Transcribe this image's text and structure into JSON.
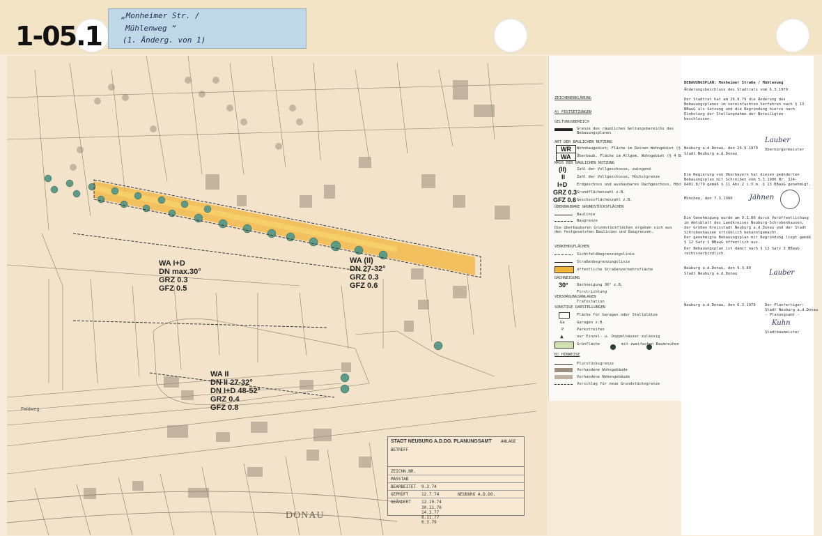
{
  "header": {
    "plan_number": "1-05.1",
    "label_line1": "„Monheimer Str. /",
    "label_line2": "Mühlenweg “",
    "label_line3": "(1. Änderg. von 1)"
  },
  "map": {
    "zones": [
      {
        "lines": [
          "WA I+D",
          "DN max.30°",
          "GRZ 0.3",
          "GFZ 0.5"
        ]
      },
      {
        "lines": [
          "WA (II)",
          "DN 27-32°",
          "GRZ 0.3",
          "GFZ 0.6"
        ]
      },
      {
        "lines": [
          "WA II",
          "DN II 27-32°",
          "DN I+D 48-52°",
          "GRZ 0.4",
          "GFZ 0.8"
        ]
      }
    ],
    "river_label": "DONAU",
    "street_label": "Feldweg",
    "highlight_color": "#f2b43a",
    "tree_color": "#5f9a86"
  },
  "title_block": {
    "office": "STADT NEUBURG A.D.DO. PLANUNGSAMT",
    "attachment": "ANLAGE",
    "subject_label": "BETREFF",
    "drawing_no_label": "ZEICHN.NR.",
    "scale_label": "MASSTAB",
    "processed_label": "BEARBEITET",
    "processed_date": "9.3.74",
    "checked_label": "GEPRÜFT",
    "checked_date": "12.7.74",
    "checked_place": "NEUBURG A.D.DO.",
    "changed_label": "GEÄNDERT",
    "changed_date": "12.10.74",
    "changed_extra": [
      "30.11.76",
      "14.3.77",
      "8.11.77",
      "6.3.79"
    ]
  },
  "legend": {
    "heading": "ZEICHENERKLÄRUNG",
    "section_a": "A) FESTSETZUNGEN",
    "boundary_heading": "GELTUNGSBEREICH",
    "boundary_text": "Grenze des räumlichen Geltungsbereichs des Bebauungsplanes",
    "use_heading": "ART DER BAULICHEN NUTZUNG",
    "wr_symbol": "WR",
    "wr_text": "Wohnbaugebiet; Fläche im Reinen Wohngebiet (§ 3 BauNV)",
    "wa_symbol": "WA",
    "wa_text": "Überbaub. Fläche im Allgem. Wohngebiet (§ 4 BauNV)",
    "measure_heading": "MASS DER BAULICHEN NUTZUNG",
    "sym_ii_circ": "(II)",
    "txt_ii_circ": "Zahl der Vollgeschosse, zwingend",
    "sym_ii": "II",
    "txt_ii": "Zahl der Vollgeschosse, Höchstgrenze",
    "sym_id": "I+D",
    "txt_id": "Erdgeschoss und ausbaubares Dachgeschoss, Höchstgrenze",
    "sym_grz": "GRZ 0.3",
    "txt_grz": "Grundflächenzahl z.B.",
    "sym_gfz": "GFZ 0.6",
    "txt_gfz": "Geschossflächenzahl z.B.",
    "building_heading": "ÜBERBAUBARE GRUNDSTÜCKSFLÄCHEN",
    "building_line": "Baulinie",
    "building_limit": "Baugrenze",
    "building_note": "Die überbaubaren Grundstückflächen ergeben sich aus den festgesetzten Baulinien und Baugrenzen.",
    "traffic_heading": "VERKEHRSFLÄCHEN",
    "traffic_1": "Sichtfeldbegrenzungslinie",
    "traffic_2": "Straßenbegrenzungslinie",
    "traffic_3": "öffentliche Straßenverkehrsfläche",
    "roof_heading": "DACHNEIGUNG",
    "roof_symbol": "30°",
    "roof_text": "Dachneigung 30° z.B.",
    "direction_text": "Firstrichtung",
    "supply_heading": "VERSORGUNGSANLAGEN",
    "transform_text": "Trafostation",
    "notes_heading": "SONSTIGE DARSTELLUNGEN",
    "garage_text": "Fläche für Garagen oder Stellplätze",
    "ga_symbol": "Ga",
    "ga_text": "Garagen z.B.",
    "p_symbol": "P",
    "p_text": "Parkstreifen",
    "house_text": "nur Einzel- u. Doppelhäuser zulässig",
    "green_text": "Grünfläche",
    "green_2": "mit zweifachen Baumreihen",
    "plant_heading": "B) HINWEISE",
    "parcel_text": "Flurstücksgrenze",
    "existing_res": "Vorhandene Wohngebäude",
    "existing_side": "Vorhandene Nebengebäude",
    "split_text": "Vorschlag für neue Grundstücksgrenze"
  },
  "procedure": {
    "title": "BEBAUUNGSPLAN: Monheimer Straße / Mühlenweg",
    "decision": "Änderungsbeschluss des Stadtrats vom 6.3.1979",
    "p1": "Der Stadtrat hat am 26.9.79 die Änderung des Bebauungsplanes im vereinfachten Verfahren nach § 13 BBauG als Satzung und die Begründung hierzu nach Einholung der Stellungnahme der Beteiligten beschlossen.",
    "place_date_1": "Neuburg a.d.Donau, den 26.9.1979",
    "city_1": "Stadt Neuburg a.d.Donau",
    "mayor": "Oberbürgermeister",
    "p2": "Die Regierung von Oberbayern hat diesen geänderten Bebauungsplan mit Schreiben vom 5.3.1980 Nr. 324-6401.8/79 gemäß § 11 Abs.2 i.V.m. § 13 BBauG genehmigt.",
    "place_date_2": "München, den 7.3.1980",
    "p3": "Die Genehmigung wurde am 9.3.80 durch Veröffentlichung im Amtsblatt des Landkreises Neuburg-Schrobenhausen, der Großen Kreisstadt Neuburg a.d.Donau und der Stadt Schrobenhausen ortsüblich bekanntgemacht.",
    "p4": "Der genehmigte Bebauungsplan mit Begründung liegt gemäß § 12 Satz 1 BBauG öffentlich aus.",
    "p5": "Der Bebauungsplan ist damit nach § 12 Satz 3 BBauG rechtsverbindlich.",
    "place_date_3": "Neuburg a.d.Donau, den 9.3.80",
    "city_3": "Stadt Neuburg a.d.Donau",
    "place_date_4": "Neuburg a.d.Donau, den 6.3.1979",
    "planner_1": "Der Planfertiger:",
    "planner_2": "Stadt Neuburg a.d.Donau",
    "planner_3": "- Planungsamt -",
    "planner_role": "Stadtbaumeister"
  }
}
